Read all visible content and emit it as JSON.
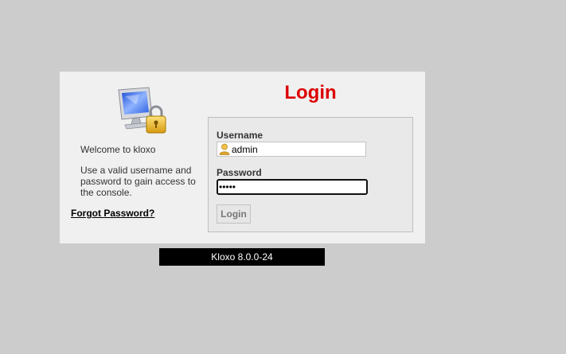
{
  "colors": {
    "page_background": "#cccccc",
    "panel_background": "#f0f0f0",
    "title_red": "#dd0000",
    "version_bar_background": "#000000"
  },
  "icons": {
    "computer": "computer-lock-icon",
    "user": "user-icon"
  },
  "sidebar": {
    "welcome": "Welcome to kloxo",
    "instructions": "Use a valid username and password to gain access to the console.",
    "forgot_password": "Forgot Password?"
  },
  "form": {
    "title": "Login",
    "username_label": "Username",
    "username_value": "admin",
    "password_label": "Password",
    "password_mask": "•••••",
    "login_button": "Login"
  },
  "footer": {
    "version": "Kloxo 8.0.0-24"
  }
}
